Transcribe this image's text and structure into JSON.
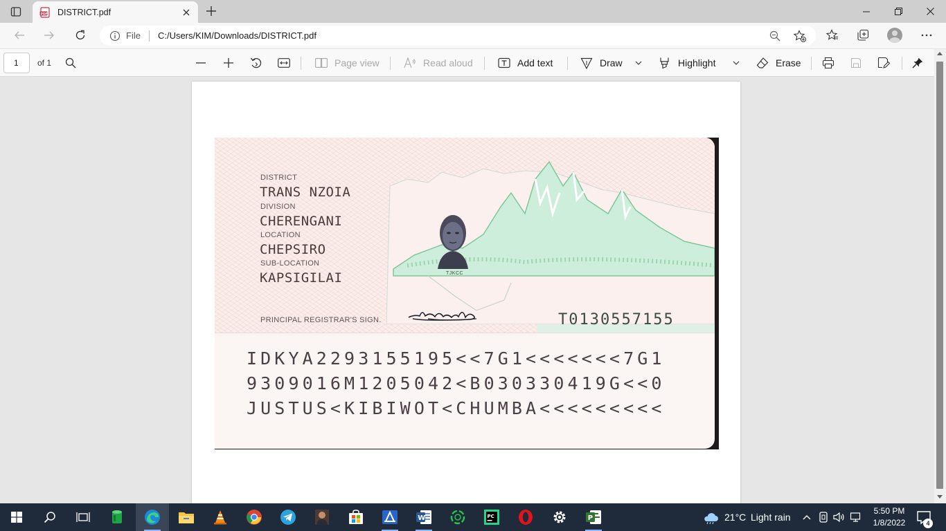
{
  "browser": {
    "tab_title": "DISTRICT.pdf",
    "address_prefix": "File",
    "url": "C:/Users/KIM/Downloads/DISTRICT.pdf"
  },
  "pdf_toolbar": {
    "page_number": "1",
    "page_total": "of 1",
    "page_view": "Page view",
    "read_aloud": "Read aloud",
    "add_text": "Add text",
    "draw": "Draw",
    "highlight": "Highlight",
    "erase": "Erase"
  },
  "id_card": {
    "district_label": "DISTRICT",
    "district_value": "TRANS NZOIA",
    "division_label": "DIVISION",
    "division_value": "CHERENGANI",
    "location_label": "LOCATION",
    "location_value": "CHEPSIRO",
    "sublocation_label": "SUB-LOCATION",
    "sublocation_value": "KAPSIGILAI",
    "photo_code": "TJKCC",
    "registrar_label": "PRINCIPAL REGISTRAR'S SIGN.",
    "serial_number": "T0130557155",
    "mrz_line1": "IDKYA2293155195<<7G1<<<<<<<7G1",
    "mrz_line2": "9309016M1205042<B030330419G<<0",
    "mrz_line3": "JUSTUS<KIBIWOT<CHUMBA<<<<<<<<<"
  },
  "taskbar": {
    "temperature": "21°C",
    "weather": "Light rain",
    "time": "5:50 PM",
    "date": "1/8/2022",
    "notification_count": "4"
  },
  "icons": {
    "tab_actions": "tab-actions-icon",
    "pdf": "pdf-file-icon",
    "close": "close-icon",
    "new_tab": "plus-icon",
    "back": "back-arrow-icon",
    "forward": "forward-arrow-icon",
    "refresh": "refresh-icon",
    "info": "info-icon",
    "zoom": "zoom-icon",
    "favorite_add": "star-plus-icon",
    "favorites": "favorites-icon",
    "collections": "collections-icon",
    "more": "more-icon"
  },
  "colors": {
    "titlebar": "#cfcfcf",
    "taskbar": "#1f2a3a",
    "card_text": "#4b3a3a",
    "mountain_green": "#7fc79a"
  }
}
